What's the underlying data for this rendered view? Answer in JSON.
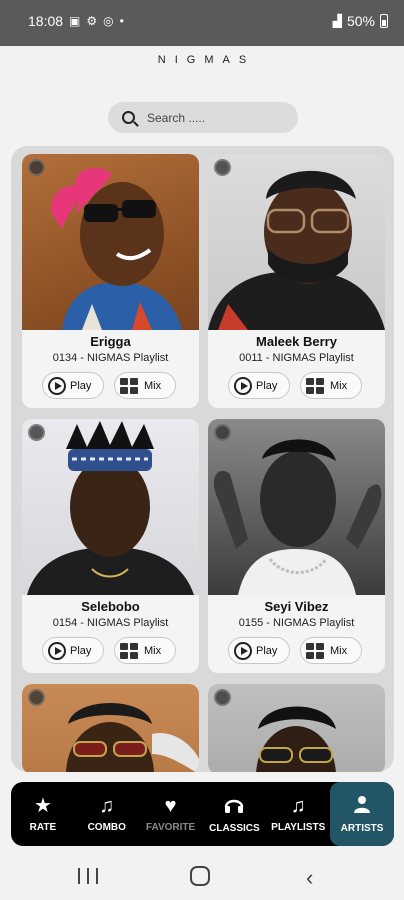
{
  "status_bar": {
    "time": "18:08",
    "battery": "50%"
  },
  "app": {
    "brand": "NIGMAS"
  },
  "search": {
    "placeholder": "Search ....."
  },
  "buttons": {
    "play": "Play",
    "mix": "Mix"
  },
  "artists": [
    {
      "name": "Erigga",
      "subtitle": "0134 - NIGMAS Playlist"
    },
    {
      "name": "Maleek Berry",
      "subtitle": "0011 - NIGMAS Playlist"
    },
    {
      "name": "Selebobo",
      "subtitle": "0154 - NIGMAS Playlist"
    },
    {
      "name": "Seyi Vibez",
      "subtitle": "0155 - NIGMAS Playlist"
    }
  ],
  "nav": {
    "items": [
      {
        "label": "RATE",
        "icon": "star-icon"
      },
      {
        "label": "COMBO",
        "icon": "music-note-icon"
      },
      {
        "label": "FAVORITE",
        "icon": "heart-icon"
      },
      {
        "label": "CLASSICS",
        "icon": "headphones-icon"
      },
      {
        "label": "PLAYLISTS",
        "icon": "music-notes-icon"
      },
      {
        "label": "ARTISTS",
        "icon": "person-icon"
      }
    ],
    "active": "ARTISTS"
  },
  "colors": {
    "active_tab": "#225666",
    "nav_bg": "#000000",
    "panel": "#d9d9d9"
  }
}
